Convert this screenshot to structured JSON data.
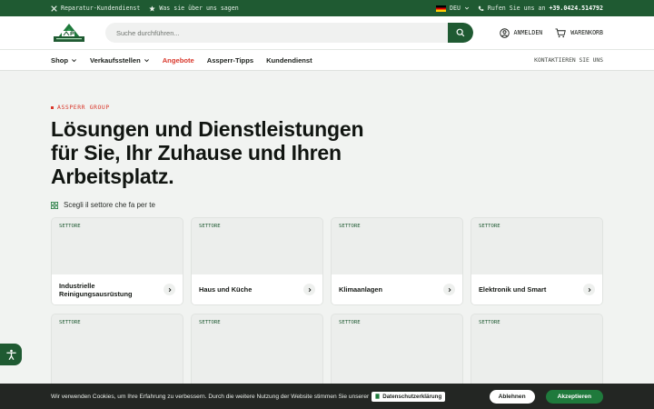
{
  "topbar": {
    "repair_service": "Reparatur-Kundendienst",
    "reviews": "Was sie über uns sagen",
    "language": "DEU",
    "call_label": "Rufen Sie uns an",
    "phone": "+39.0424.514792"
  },
  "header": {
    "search_placeholder": "Suche durchführen...",
    "login": "ANMELDEN",
    "cart": "WARENKORB"
  },
  "nav": {
    "items": [
      {
        "label": "Shop",
        "dropdown": true
      },
      {
        "label": "Verkaufsstellen",
        "dropdown": true
      },
      {
        "label": "Angebote",
        "highlight": true
      },
      {
        "label": "Assperr-Tipps"
      },
      {
        "label": "Kundendienst"
      }
    ],
    "contact": "KONTAKTIEREN SIE UNS"
  },
  "hero": {
    "eyebrow": "ASSPERR GROUP",
    "headline": "Lösungen und Dienstleistungen für Sie, Ihr Zuhause und Ihren Arbeitsplatz.",
    "sub": "Scegli il settore che fa per te"
  },
  "sectors": {
    "tag": "SETTORE",
    "cards": [
      "Industrielle Reinigungsausrüstung",
      "Haus und Küche",
      "Klimaanlagen",
      "Elektronik und Smart"
    ]
  },
  "cookie": {
    "message": "Wir verwenden Cookies, um Ihre Erfahrung zu verbessern. Durch die weitere Nutzung der Website stimmen Sie unserer",
    "privacy": "Datenschutzerklärung",
    "reject": "Ablehnen",
    "accept": "Akzeptieren"
  },
  "colors": {
    "brand_green": "#1f5a32",
    "offer_red": "#d9372b",
    "accept_green": "#1f7a3c"
  },
  "icons": [
    "tools-icon",
    "star-icon",
    "flag-de-icon",
    "phone-icon",
    "search-icon",
    "user-icon",
    "cart-icon",
    "chevron-down-icon",
    "grid-icon",
    "chevron-right-icon",
    "accessibility-icon"
  ]
}
